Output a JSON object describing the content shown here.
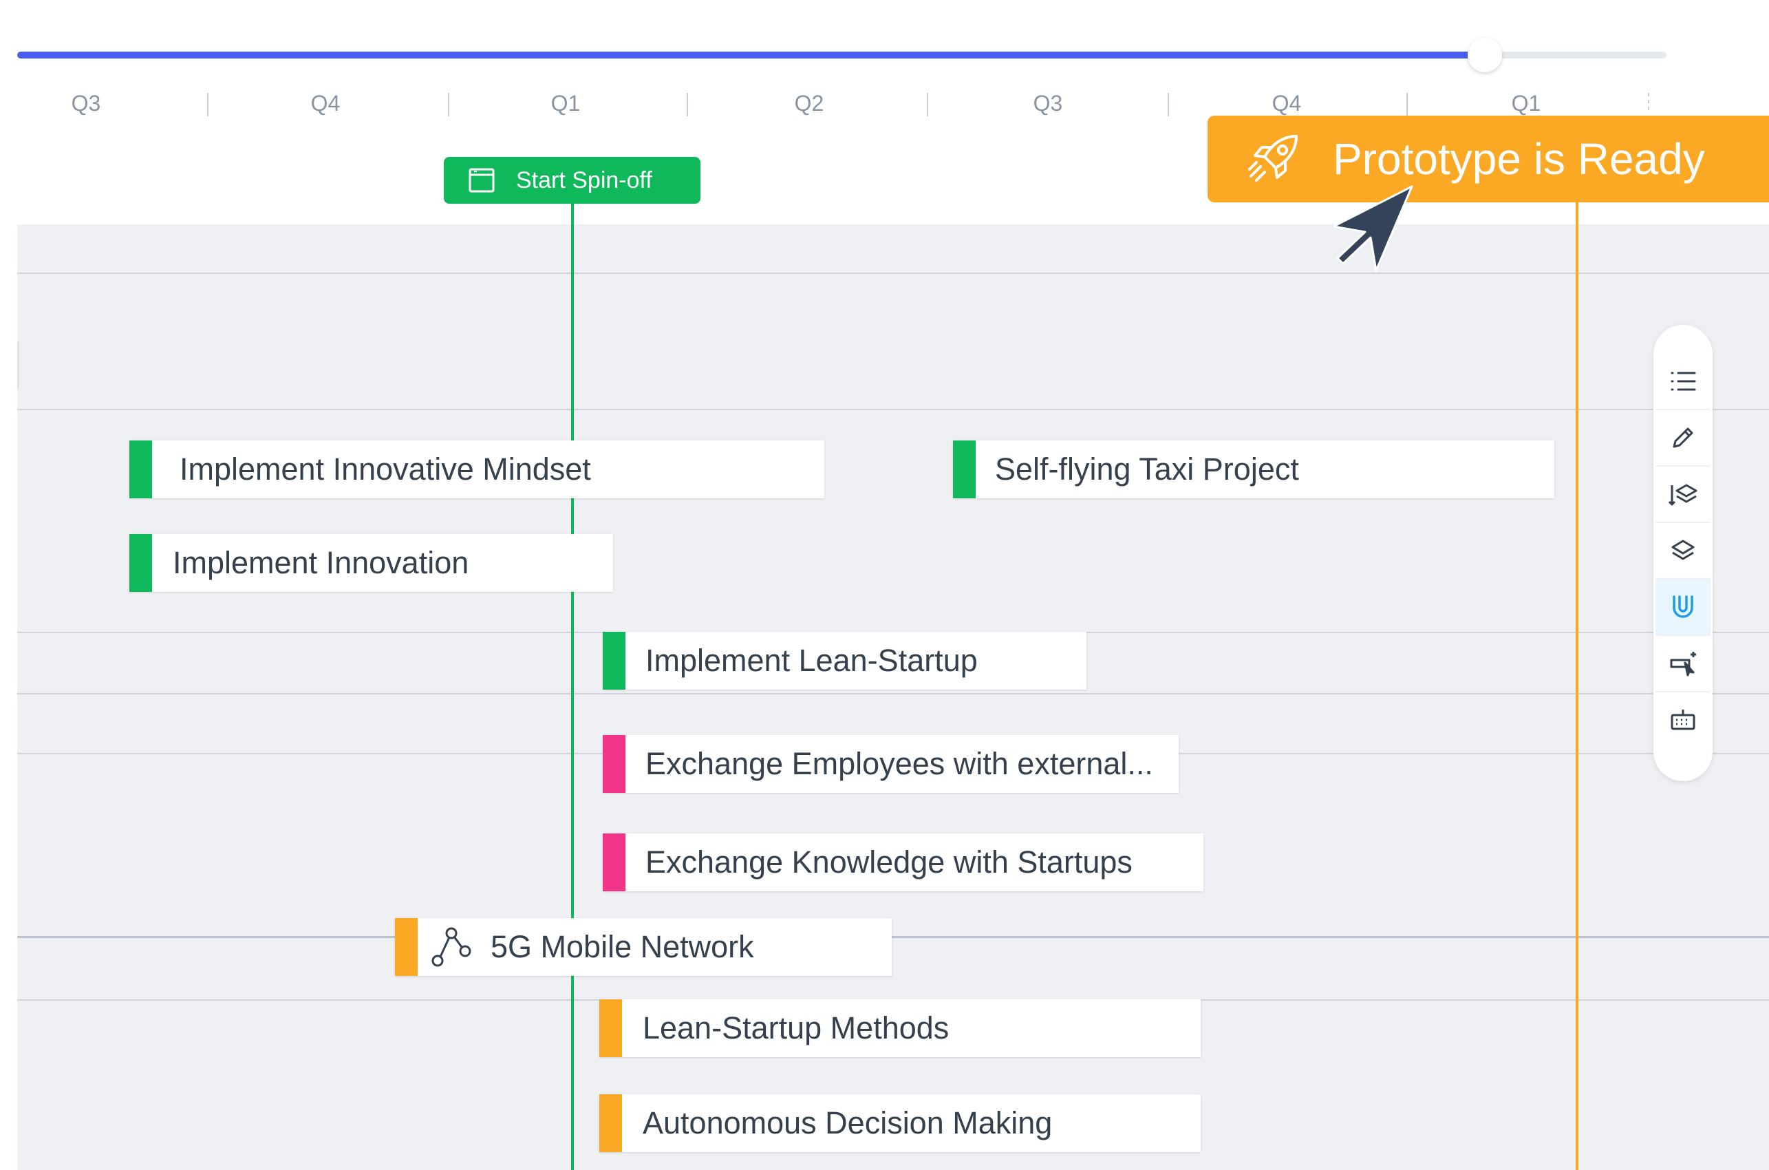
{
  "colors": {
    "background": "#eff0f3",
    "accent_blue": "#4c5ef1",
    "green": "#0fb85a",
    "pink": "#f23488",
    "orange": "#fba825",
    "text": "#36404d",
    "active_toolbar_icon": "#1e9be6"
  },
  "timeline": {
    "slider_progress": 0.89,
    "quarters": [
      "Q3",
      "Q4",
      "Q1",
      "Q2",
      "Q3",
      "Q4",
      "Q1"
    ]
  },
  "milestones": {
    "spinoff": {
      "label": "Start Spin-off",
      "icon": "calendar-icon"
    },
    "prototype": {
      "label": "Prototype is Ready",
      "icon": "rocket-icon"
    }
  },
  "items": [
    {
      "label": "Implement Innovative Mindset",
      "color": "green"
    },
    {
      "label": "Self-flying Taxi Project",
      "color": "green"
    },
    {
      "label": "Implement Innovation",
      "color": "green"
    },
    {
      "label": "Implement Lean-Startup",
      "color": "green"
    },
    {
      "label": "Exchange Employees with external...",
      "color": "pink"
    },
    {
      "label": "Exchange Knowledge with Startups",
      "color": "pink"
    },
    {
      "label": "5G Mobile Network",
      "color": "orange",
      "icon": "dependency-icon"
    },
    {
      "label": "Lean-Startup Methods",
      "color": "orange"
    },
    {
      "label": "Autonomous Decision Making",
      "color": "orange"
    }
  ],
  "toolbar": {
    "buttons": [
      "list-icon",
      "pencil-icon",
      "layers-down-icon",
      "layers-icon",
      "magnet-icon",
      "add-cursor-icon",
      "keyboard-icon"
    ],
    "active": "magnet-icon"
  }
}
